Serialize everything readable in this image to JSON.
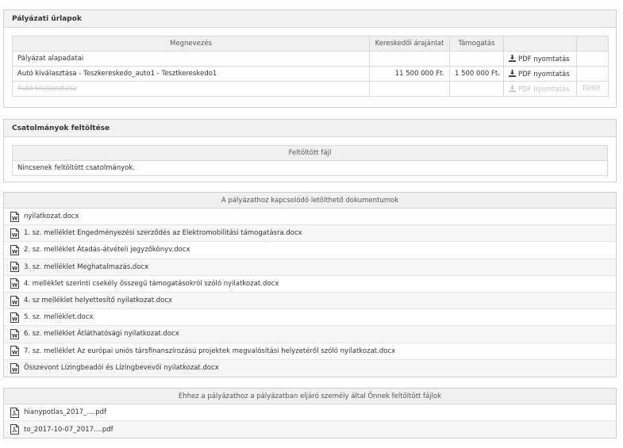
{
  "forms": {
    "title": "Pályázati űrlapok",
    "columns": [
      "Megnevezés",
      "Kereskedői árajánlat",
      "Támogatás",
      "",
      ""
    ],
    "rows": [
      {
        "name": "Pályázat alapadatai",
        "offer": "",
        "support": "",
        "pdf": "PDF nyomtatás",
        "status": ""
      },
      {
        "name": "Autó kiválasztása - Teszkereskedo_auto1 - Tesztkereskedo1",
        "offer": "11 500 000 Ft.",
        "support": "1 500 000 Ft.",
        "pdf": "PDF nyomtatás",
        "status": ""
      },
      {
        "name": "Autó kiválasztása",
        "offer": "",
        "support": "",
        "pdf": "PDF nyomtatás",
        "status": "Törölt"
      }
    ]
  },
  "attachments": {
    "title": "Csatolmányok feltöltése",
    "column": "Feltöltött fájl",
    "empty_text": "Nincsenek feltöltött csatolmányok."
  },
  "documents": {
    "header": "A pályázathoz kapcsolódó letölthető dokumentumok",
    "items": [
      "nyilatkozat.docx",
      "1. sz. melléklet Engedményezési szerződés az Elektromobilitási támogatásra.docx",
      "2. sz. melléklet Átadás-átvételi jegyzőkönyv.docx",
      "3. sz. melléklet Meghatalmazás.docx",
      "4. melléklet szerinti csekély összegű támogatásokról szóló nyilatkozat.docx",
      "4. sz melléklet helyettesítő nyilatkozat.docx",
      "5. sz. melléklet.docx",
      "6. sz. melléklet Átláthatósági nyilatkozat.docx",
      "7. sz. melléklet Az európai uniós társfinanszírozású projektek megvalósítási helyzetéről szóló nyilatkozat.docx",
      "Összevont Lízingbeadói és Lízingbevevői nyilatkozat.docx"
    ]
  },
  "uploaded": {
    "header": "Ehhez a pályázathoz a pályázatban eljáró személy által Önnek feltöltött fájlok",
    "items": [
      "hianypotlas_2017_....pdf",
      "to_2017-10-07_2017....pdf"
    ]
  },
  "icons": {
    "download": "download-icon",
    "word": "word-doc-icon",
    "pdf": "pdf-file-icon"
  }
}
